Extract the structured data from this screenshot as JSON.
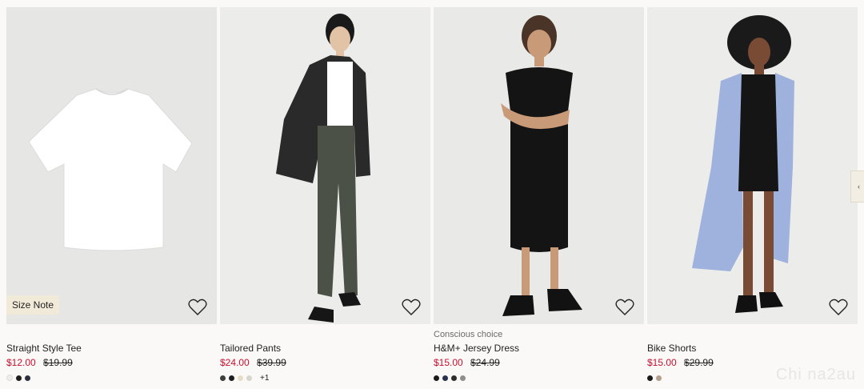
{
  "products": [
    {
      "tag": "",
      "name": "Straight Style Tee",
      "price": "$12.00",
      "old_price": "$19.99",
      "badge": "Size Note",
      "swatches": [
        "#efece6",
        "#1f1f1f",
        "#2b3040"
      ],
      "more": "",
      "image_bg": "#e6e6e4"
    },
    {
      "tag": "",
      "name": "Tailored Pants",
      "price": "$24.00",
      "old_price": "$39.99",
      "badge": "",
      "swatches": [
        "#3c3f3b",
        "#1e1e1e",
        "#e7dcc6",
        "#d9d5cc"
      ],
      "more": "+1",
      "image_bg": "#ececea"
    },
    {
      "tag": "Conscious choice",
      "name": "H&M+ Jersey Dress",
      "price": "$15.00",
      "old_price": "$24.99",
      "badge": "",
      "swatches": [
        "#1b1b1b",
        "#27324d",
        "#2d2d2d",
        "#8e8e8e"
      ],
      "more": "",
      "image_bg": "#e9e9e7"
    },
    {
      "tag": "",
      "name": "Bike Shorts",
      "price": "$15.00",
      "old_price": "$29.99",
      "badge": "",
      "swatches": [
        "#1b1b1b",
        "#b59f8c"
      ],
      "more": "",
      "image_bg": "#ececea"
    }
  ],
  "icons": {
    "favorite": "heart-outline-icon",
    "next": "chevron-right-icon"
  },
  "colors": {
    "sale_price": "#c8102e",
    "badge_bg": "#f2ead9"
  },
  "watermark": "Chi na2au"
}
